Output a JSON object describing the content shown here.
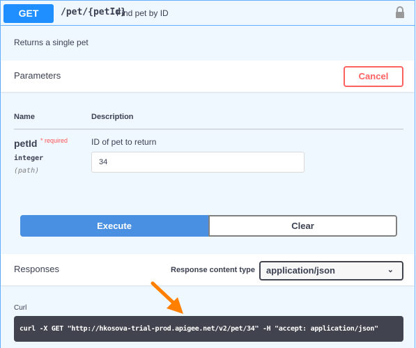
{
  "header": {
    "method": "GET",
    "path": "/pet/{petId}",
    "summary": "Find pet by ID"
  },
  "description": "Returns a single pet",
  "parameters": {
    "title": "Parameters",
    "cancel_label": "Cancel",
    "col_name": "Name",
    "col_description": "Description",
    "items": [
      {
        "name": "petId",
        "required": "* required",
        "type": "integer",
        "in": "(path)",
        "description": "ID of pet to return",
        "value": "34"
      }
    ]
  },
  "actions": {
    "execute": "Execute",
    "clear": "Clear"
  },
  "responses": {
    "title": "Responses",
    "content_type_label": "Response content type",
    "content_type": "application/json"
  },
  "curl": {
    "label": "Curl",
    "command": "curl -X GET \"http://hkosova-trial-prod.apigee.net/v2/pet/34\" -H  \"accept: application/json\""
  },
  "colors": {
    "method": "#1f8fff",
    "cancel": "#ff6060",
    "execute": "#4990e2",
    "annotation_arrow": "#ff8000"
  }
}
